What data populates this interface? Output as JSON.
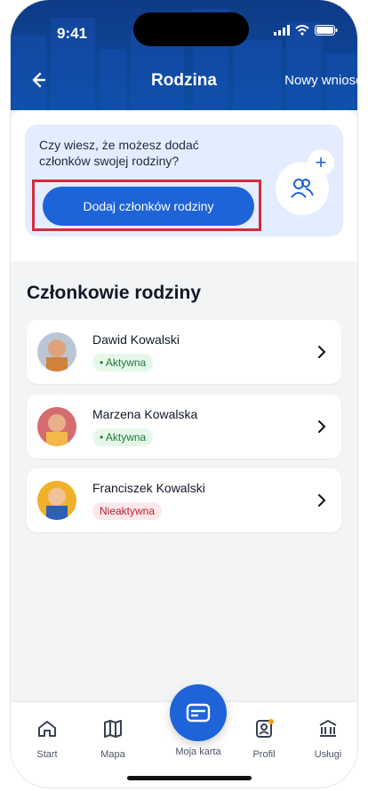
{
  "status": {
    "time": "9:41"
  },
  "header": {
    "title": "Rodzina",
    "action_label": "Nowy wniosek"
  },
  "promo": {
    "text": "Czy wiesz, że możesz dodać członków swojej rodziny?",
    "button_label": "Dodaj członków rodziny"
  },
  "section": {
    "title": "Członkowie rodziny"
  },
  "members": [
    {
      "name": "Dawid Kowalski",
      "status": "• Aktywna"
    },
    {
      "name": "Marzena Kowalska",
      "status": "• Aktywna"
    },
    {
      "name": "Franciszek Kowalski",
      "status": "Nieaktywna"
    }
  ],
  "nav": {
    "items": [
      {
        "label": "Start"
      },
      {
        "label": "Mapa"
      },
      {
        "label": "Moja karta"
      },
      {
        "label": "Profil"
      },
      {
        "label": "Usługi"
      }
    ]
  },
  "colors": {
    "header": "#0b4ea2",
    "primary": "#1e63d8",
    "promo_bg": "#e3edff",
    "highlight_border": "#d62b3a",
    "active_badge_bg": "#e6f7ea",
    "inactive_badge_bg": "#fde7ea"
  },
  "icons": [
    "back-arrow-icon",
    "signal-icon",
    "wifi-icon",
    "battery-icon",
    "add-family-icon",
    "plus-icon",
    "chevron-right-icon",
    "home-icon",
    "map-icon",
    "card-icon",
    "profile-icon",
    "services-icon"
  ]
}
